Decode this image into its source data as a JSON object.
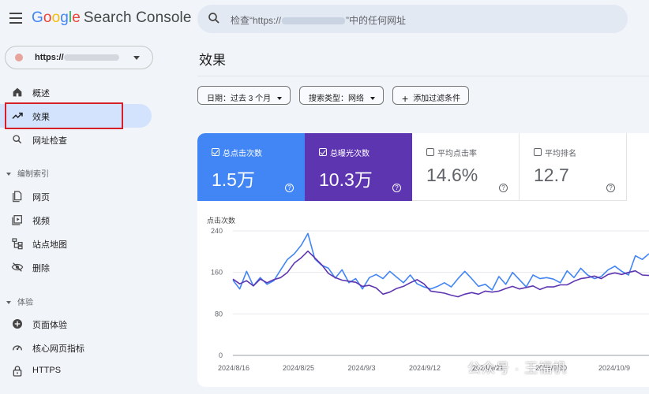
{
  "header": {
    "logo_letters": [
      "G",
      "o",
      "o",
      "g",
      "l",
      "e"
    ],
    "app_name": "Search Console",
    "search": {
      "prefix": "检查“https://",
      "suffix": "”中的任何网址"
    }
  },
  "property": {
    "prefix": "https://"
  },
  "sidebar": {
    "items": [
      {
        "label": "概述",
        "icon": "home-icon"
      },
      {
        "label": "效果",
        "icon": "trending-up-icon",
        "active": true
      },
      {
        "label": "网址检查",
        "icon": "search-icon"
      }
    ],
    "sections": [
      {
        "title": "编制索引",
        "items": [
          {
            "label": "网页",
            "icon": "pages-icon"
          },
          {
            "label": "视频",
            "icon": "video-icon"
          },
          {
            "label": "站点地图",
            "icon": "sitemap-icon"
          },
          {
            "label": "删除",
            "icon": "removal-icon"
          }
        ]
      },
      {
        "title": "体验",
        "items": [
          {
            "label": "页面体验",
            "icon": "page-experience-icon"
          },
          {
            "label": "核心网页指标",
            "icon": "speed-gauge-icon"
          },
          {
            "label": "HTTPS",
            "icon": "lock-icon"
          }
        ]
      }
    ]
  },
  "main": {
    "title": "效果",
    "filters": {
      "date": "日期：过去 3 个月",
      "search_type": "搜索类型：网络",
      "add_filter": "添加过滤条件"
    },
    "metrics": [
      {
        "label": "总点击次数",
        "value": "1.5万",
        "checked": true,
        "color": "#4285f4"
      },
      {
        "label": "总曝光次数",
        "value": "10.3万",
        "checked": true,
        "color": "#5e35b1"
      },
      {
        "label": "平均点击率",
        "value": "14.6%",
        "checked": false
      },
      {
        "label": "平均排名",
        "value": "12.7",
        "checked": false
      }
    ],
    "help_glyph": "?"
  },
  "chart_data": {
    "type": "line",
    "ylabel": "点击次数",
    "y_ticks": [
      0,
      80,
      160,
      240
    ],
    "ylim": [
      0,
      240
    ],
    "x_ticks": [
      "2024/8/16",
      "2024/8/25",
      "2024/9/3",
      "2024/9/12",
      "2024/9/21",
      "2024/9/30",
      "2024/10/9"
    ],
    "grid": true,
    "series": [
      {
        "color": "#4285f4",
        "values": [
          145,
          128,
          162,
          134,
          150,
          137,
          144,
          165,
          185,
          196,
          212,
          235,
          186,
          174,
          168,
          149,
          165,
          140,
          148,
          128,
          150,
          156,
          148,
          162,
          151,
          140,
          155,
          138,
          132,
          128,
          133,
          140,
          132,
          148,
          162,
          148,
          133,
          137,
          126,
          152,
          137,
          160,
          146,
          132,
          155,
          148,
          150,
          147,
          140,
          163,
          150,
          168,
          155,
          148,
          152,
          165,
          172,
          162,
          155,
          192,
          185,
          196
        ]
      },
      {
        "color": "#5e35b1",
        "values": [
          147,
          138,
          144,
          134,
          147,
          140,
          146,
          150,
          160,
          178,
          188,
          201,
          188,
          175,
          158,
          150,
          145,
          143,
          141,
          133,
          135,
          130,
          118,
          122,
          129,
          133,
          140,
          146,
          138,
          124,
          122,
          120,
          116,
          113,
          118,
          121,
          118,
          124,
          122,
          124,
          129,
          133,
          128,
          131,
          134,
          127,
          132,
          132,
          136,
          136,
          143,
          148,
          150,
          153,
          148,
          156,
          159,
          156,
          160,
          163,
          155,
          154
        ]
      }
    ]
  },
  "watermark": "公众号 · 王福帆"
}
